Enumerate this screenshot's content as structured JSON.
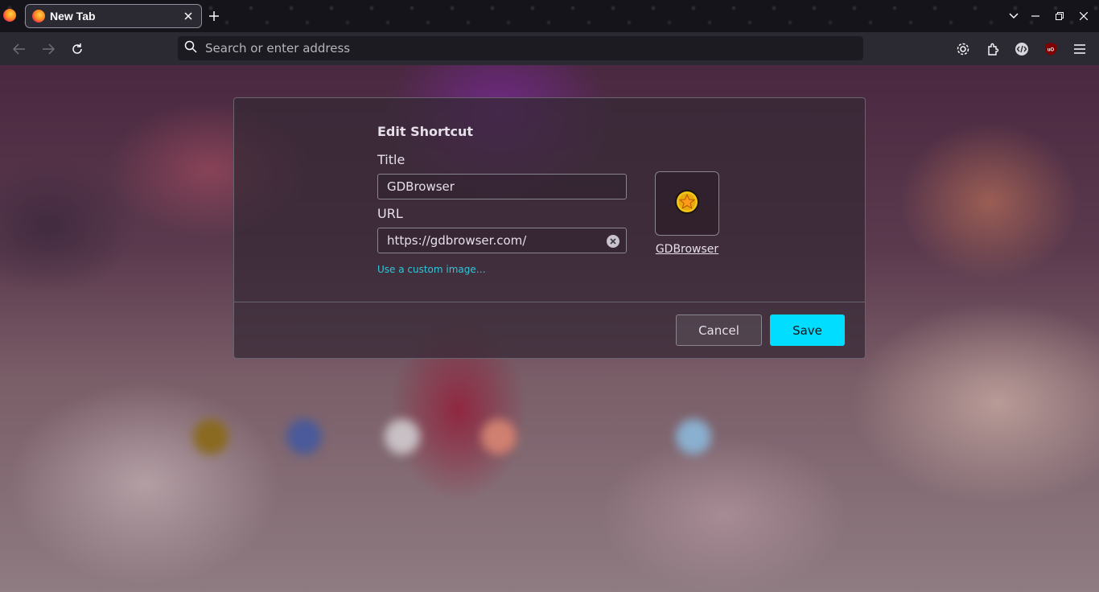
{
  "browser": {
    "tab": {
      "title": "New Tab"
    },
    "urlbar": {
      "placeholder": "Search or enter address"
    }
  },
  "dialog": {
    "heading": "Edit Shortcut",
    "title_label": "Title",
    "title_value": "GDBrowser",
    "url_label": "URL",
    "url_value": "https://gdbrowser.com/",
    "custom_image_link": "Use a custom image…",
    "preview_name": "GDBrowser",
    "cancel_label": "Cancel",
    "save_label": "Save"
  },
  "colors": {
    "accent": "#00ddff",
    "link": "#2fc7da",
    "toolbar": "#2b2a33",
    "tabstrip": "#15141a"
  },
  "icons": {
    "tabstrip": [
      "firefox-logo-icon",
      "tab-favicon-icon",
      "close-icon",
      "plus-icon",
      "chevron-down-icon",
      "minimize-icon",
      "restore-icon",
      "close-window-icon"
    ],
    "toolbar": [
      "back-arrow-icon",
      "forward-arrow-icon",
      "reload-icon",
      "search-icon",
      "gear-icon",
      "extensions-icon",
      "devtools-icon",
      "ublock-icon",
      "hamburger-menu-icon"
    ],
    "dialog": [
      "clear-icon",
      "star-coin-icon"
    ]
  }
}
